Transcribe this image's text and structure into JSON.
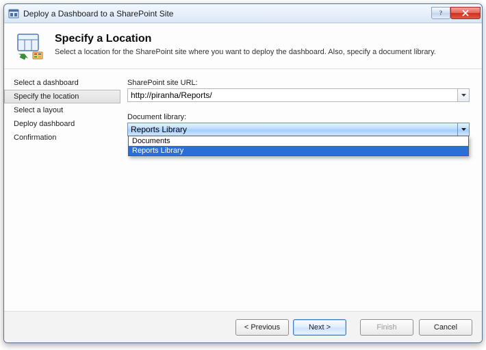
{
  "window": {
    "title": "Deploy a Dashboard to a SharePoint Site"
  },
  "header": {
    "title": "Specify a Location",
    "subtitle": "Select a location for the SharePoint site where you want to deploy the dashboard. Also, specify a document library."
  },
  "steps": {
    "items": [
      {
        "label": "Select a dashboard"
      },
      {
        "label": "Specify the location"
      },
      {
        "label": "Select a layout"
      },
      {
        "label": "Deploy dashboard"
      },
      {
        "label": "Confirmation"
      }
    ],
    "active_index": 1
  },
  "form": {
    "url_label": "SharePoint site URL:",
    "url_value": "http://piranha/Reports/",
    "library_label": "Document library:",
    "library_value": "Reports Library",
    "library_options": [
      {
        "label": "Documents"
      },
      {
        "label": "Reports Library"
      }
    ],
    "library_selected_index": 1
  },
  "footer": {
    "previous": "< Previous",
    "next": "Next >",
    "finish": "Finish",
    "cancel": "Cancel"
  }
}
